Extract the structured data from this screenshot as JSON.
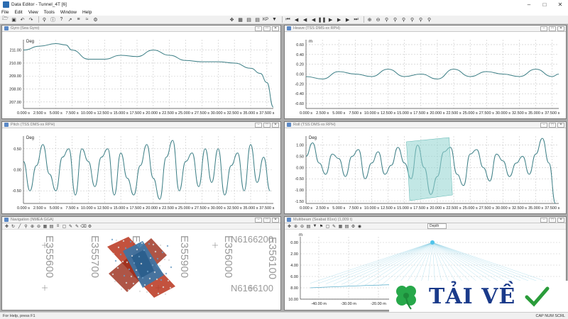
{
  "window": {
    "title": "Data Editor - Tunnel_4T [6]"
  },
  "menu": [
    "File",
    "Edit",
    "View",
    "Tools",
    "Window",
    "Help"
  ],
  "toolbar": {
    "kp_label": "KP"
  },
  "status": {
    "left": "For Help, press F1",
    "right": "CAP NUM SCRL"
  },
  "watermark": {
    "text": "TẢI VỀ"
  },
  "x_ticks": [
    "0.000 s",
    "2.500 s",
    "5.000 s",
    "7.500 s",
    "10.000 s",
    "12.500 s",
    "15.000 s",
    "17.500 s",
    "20.000 s",
    "22.500 s",
    "25.000 s",
    "27.500 s",
    "30.000 s",
    "32.500 s",
    "35.000 s",
    "37.500 s"
  ],
  "panes": {
    "gyro": {
      "title": "Gyro (Sea Gyro)",
      "unit": "Deg",
      "yticks": [
        "211.00",
        "210.00",
        "209.00",
        "208.00",
        "207.00"
      ]
    },
    "heave": {
      "title": "Heave (TSS DMS-xx RPH)",
      "unit": "m",
      "yticks": [
        "0.60",
        "0.40",
        "0.20",
        "0.00",
        "-0.20",
        "-0.40",
        "-0.60"
      ]
    },
    "pitch": {
      "title": "Pitch (TSS DMS-xx RPH)",
      "unit": "Deg",
      "yticks": [
        "0.50",
        "0.00",
        "-0.50"
      ]
    },
    "roll": {
      "title": "Roll (TSS DMS-xx RPH)",
      "unit": "Deg",
      "yticks": [
        "1.00",
        "0.50",
        "0.00",
        "-0.50",
        "-1.00",
        "-1.50"
      ]
    },
    "nav": {
      "title": "Navigation (NMEA GGA)",
      "labels_e": [
        "E355600",
        "E355700",
        "E355800",
        "E355900",
        "E356000",
        "E356100"
      ],
      "labels_n": [
        "N6166200",
        "N6166100"
      ]
    },
    "mb": {
      "title": "Multibeam (Seabat 81xx) (1,009 t)",
      "unit": "m",
      "depth_label": "Depth",
      "yticks": [
        "0.00",
        "2.00",
        "4.00",
        "6.00",
        "8.00",
        "10.00"
      ],
      "xticks": [
        "-40.00 m",
        "-30.00 m",
        "-20.00 m"
      ]
    }
  },
  "chart_data": [
    {
      "type": "line",
      "title": "Gyro (Sea Gyro)",
      "ylabel": "Deg",
      "xlabel": "",
      "ylim": [
        206.5,
        211.8
      ],
      "x": [
        0,
        2.5,
        5,
        6.5,
        7.5,
        10,
        12.5,
        15,
        17.5,
        20,
        22.5,
        25,
        27.5,
        30,
        32.5,
        35,
        36.5,
        37.5,
        38.5
      ],
      "values": [
        211.0,
        211.3,
        211.5,
        211.4,
        211.0,
        210.3,
        210.3,
        210.6,
        210.5,
        211.0,
        210.6,
        210.2,
        210.1,
        210.1,
        210.0,
        209.6,
        209.2,
        208.5,
        206.6
      ]
    },
    {
      "type": "line",
      "title": "Heave (TSS DMS-xx RPH)",
      "ylabel": "m",
      "xlabel": "",
      "ylim": [
        -0.7,
        0.7
      ],
      "x": [
        0,
        2.5,
        5,
        7.5,
        10,
        12.5,
        15,
        17.5,
        20,
        22.5,
        25,
        27.5,
        30,
        32.5,
        35,
        37.5,
        38.5
      ],
      "values": [
        -0.05,
        -0.1,
        0.05,
        0.0,
        -0.05,
        0.1,
        -0.05,
        0.0,
        -0.1,
        0.1,
        -0.05,
        0.05,
        0.0,
        -0.05,
        0.1,
        -0.05,
        0.0
      ]
    },
    {
      "type": "line",
      "title": "Pitch (TSS DMS-xx RPH)",
      "ylabel": "Deg",
      "xlabel": "",
      "ylim": [
        -0.8,
        0.8
      ],
      "x": [
        0,
        1,
        2,
        3,
        4,
        5,
        6,
        7,
        8,
        9,
        10,
        11,
        12,
        13,
        14,
        15,
        16,
        17,
        18,
        19,
        20,
        21,
        22,
        23,
        24,
        25,
        26,
        27,
        28,
        29,
        30,
        31,
        32,
        33,
        34,
        35,
        36,
        37,
        38
      ],
      "values": [
        0.2,
        -0.5,
        0.1,
        0.6,
        -0.1,
        -0.5,
        0.3,
        0.5,
        -0.6,
        0.5,
        0.2,
        -0.4,
        0.3,
        0.5,
        -0.6,
        0.4,
        -0.2,
        -0.6,
        0.1,
        0.6,
        -0.2,
        -0.7,
        0.3,
        0.7,
        -0.5,
        0.2,
        0.4,
        -0.4,
        0.5,
        -0.3,
        0.5,
        -0.6,
        0.1,
        0.4,
        -0.5,
        0.6,
        -0.3,
        0.3,
        -0.5
      ]
    },
    {
      "type": "line",
      "title": "Roll (TSS DMS-xx RPH)",
      "ylabel": "Deg",
      "xlabel": "",
      "ylim": [
        -1.6,
        1.4
      ],
      "x": [
        0,
        1,
        2,
        3,
        4,
        5,
        6,
        7,
        8,
        9,
        10,
        11,
        12,
        13,
        14,
        15,
        16,
        17,
        18,
        19,
        20,
        21,
        22,
        23,
        24,
        25,
        26,
        27,
        28,
        29,
        30,
        31,
        32,
        33,
        34,
        35,
        36,
        37,
        38
      ],
      "values": [
        0.5,
        1.1,
        0.2,
        -0.3,
        0.6,
        0.4,
        -0.4,
        0.5,
        0.8,
        -0.5,
        0.2,
        0.7,
        -0.3,
        0.1,
        0.9,
        0.2,
        -0.5,
        1.0,
        0.0,
        -1.2,
        -0.4,
        0.7,
        0.9,
        -0.3,
        -0.8,
        0.6,
        0.8,
        0.0,
        -0.6,
        0.6,
        0.3,
        -0.4,
        0.2,
        0.5,
        -0.3,
        0.6,
        1.3,
        0.2,
        -1.6
      ]
    }
  ]
}
